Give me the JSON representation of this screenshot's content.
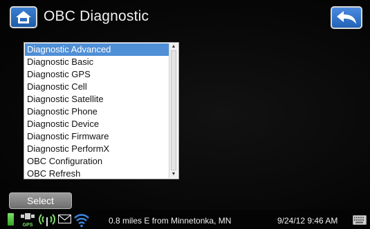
{
  "header": {
    "title": "OBC Diagnostic",
    "home_icon": "home-icon",
    "back_icon": "back-arrow-icon"
  },
  "menu": {
    "items": [
      {
        "label": "Diagnostic Advanced",
        "selected": true
      },
      {
        "label": "Diagnostic Basic"
      },
      {
        "label": "Diagnostic GPS"
      },
      {
        "label": "Diagnostic Cell"
      },
      {
        "label": "Diagnostic Satellite"
      },
      {
        "label": "Diagnostic Phone"
      },
      {
        "label": "Diagnostic Device"
      },
      {
        "label": "Diagnostic Firmware"
      },
      {
        "label": "Diagnostic PerformX"
      },
      {
        "label": "OBC Configuration"
      },
      {
        "label": "OBC Refresh"
      }
    ]
  },
  "footer": {
    "select_label": "Select"
  },
  "status": {
    "gps_label": "GPS",
    "location": "0.8 miles E from Minnetonka, MN",
    "datetime": "9/24/12 9:46 AM",
    "icons": [
      "battery-icon",
      "gps-icon",
      "signal-icon",
      "mail-icon",
      "wifi-icon",
      "keyboard-icon"
    ]
  },
  "colors": {
    "accent_blue": "#4f8fd6",
    "background": "#050505",
    "battery_green": "#36a326"
  }
}
